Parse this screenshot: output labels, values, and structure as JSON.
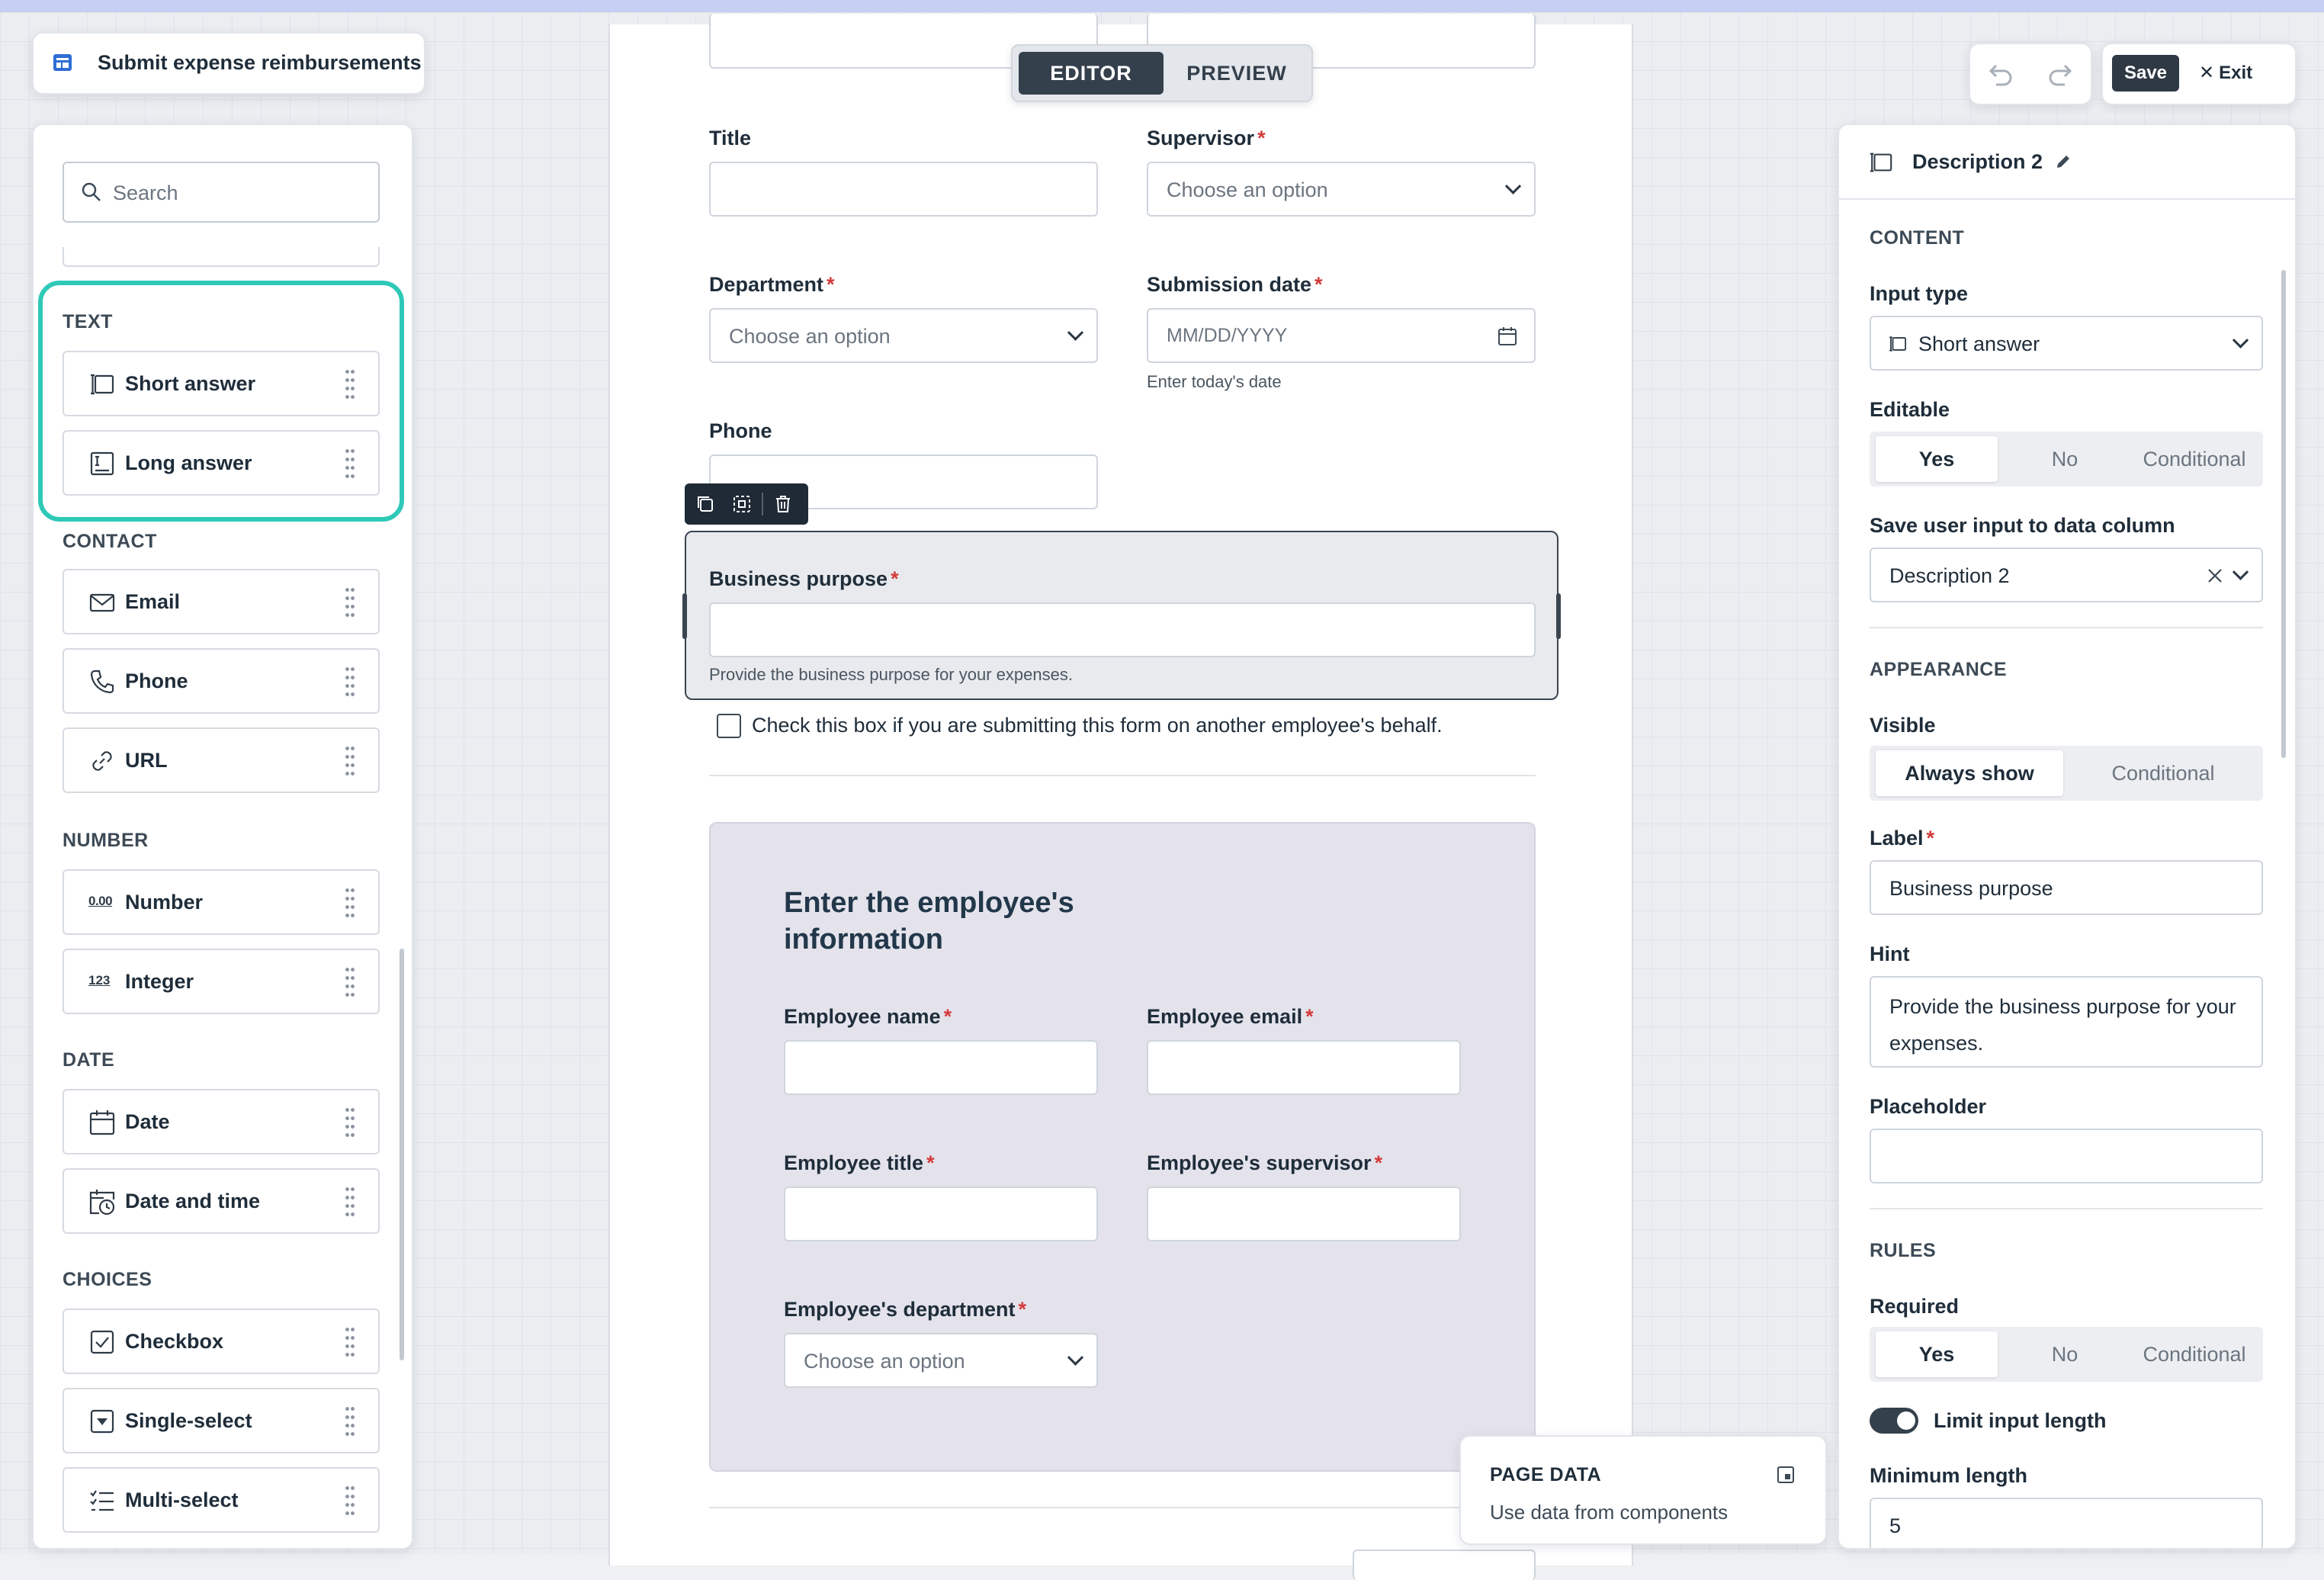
{
  "header": {
    "app_title": "Submit expense reimbursements",
    "mode_tabs": [
      "EDITOR",
      "PREVIEW"
    ],
    "save_label": "Save",
    "exit_label": "Exit"
  },
  "palette": {
    "search_placeholder": "Search",
    "sections": {
      "text": "TEXT",
      "contact": "CONTACT",
      "number": "NUMBER",
      "date": "DATE",
      "choices": "CHOICES"
    },
    "items": {
      "short_answer": "Short answer",
      "long_answer": "Long answer",
      "email": "Email",
      "phone": "Phone",
      "url": "URL",
      "number": "Number",
      "integer": "Integer",
      "date": "Date",
      "date_time": "Date and time",
      "checkbox": "Checkbox",
      "single_select": "Single-select",
      "multi_select": "Multi-select"
    },
    "icon_text": {
      "number": "0.00",
      "integer": "123"
    },
    "highlight_color": "#2ec9b7"
  },
  "form": {
    "title_label": "Title",
    "supervisor_label": "Supervisor",
    "supervisor_placeholder": "Choose an option",
    "department_label": "Department",
    "department_placeholder": "Choose an option",
    "submission_date_label": "Submission date",
    "submission_date_placeholder": "MM/DD/YYYY",
    "submission_date_hint": "Enter today's date",
    "phone_label": "Phone",
    "business_purpose_label": "Business purpose",
    "business_purpose_hint": "Provide the business purpose for your expenses.",
    "behalf_checkbox_label": "Check this box if you are submitting this form on another employee's behalf.",
    "employee_section": {
      "heading_line1": "Enter the employee's",
      "heading_line2": "information",
      "name_label": "Employee name",
      "email_label": "Employee email",
      "title_label": "Employee title",
      "supervisor_label": "Employee's supervisor",
      "department_label": "Employee's department",
      "department_placeholder": "Choose an option"
    }
  },
  "page_data_card": {
    "title": "PAGE DATA",
    "subtitle": "Use data from components"
  },
  "inspector": {
    "title": "Description 2",
    "content_heading": "CONTENT",
    "input_type_label": "Input type",
    "input_type_value": "Short answer",
    "editable_label": "Editable",
    "editable_options": [
      "Yes",
      "No",
      "Conditional"
    ],
    "save_column_label": "Save user input to data column",
    "save_column_value": "Description 2",
    "appearance_heading": "APPEARANCE",
    "visible_label": "Visible",
    "visible_options": [
      "Always show",
      "Conditional"
    ],
    "label_label": "Label",
    "label_value": "Business purpose",
    "hint_label": "Hint",
    "hint_value": "Provide the business purpose for your expenses.",
    "placeholder_label": "Placeholder",
    "placeholder_value": "",
    "rules_heading": "RULES",
    "required_label": "Required",
    "required_options": [
      "Yes",
      "No",
      "Conditional"
    ],
    "limit_length_label": "Limit input length",
    "min_length_label": "Minimum length",
    "min_length_value": "5"
  },
  "colors": {
    "accent_dark": "#333d47",
    "required": "#d43a3a",
    "section_bg": "#e4e3ec"
  }
}
